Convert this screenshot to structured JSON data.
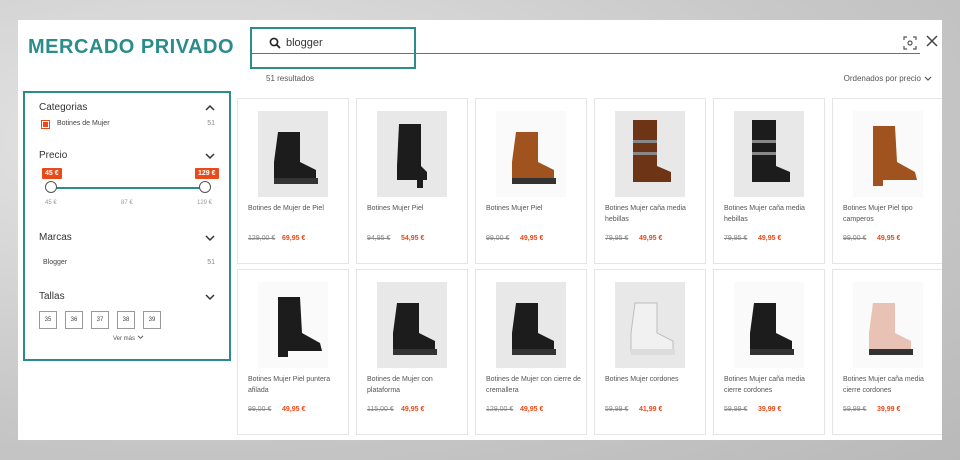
{
  "brand": {
    "logo_text": "MERCADO PRIVADO",
    "accent_color": "#2a8c8c",
    "sale_color": "#e84a1a"
  },
  "search": {
    "query": "blogger",
    "icon": "search-icon"
  },
  "toolbar": {
    "scan_icon": "scan-icon",
    "close_icon": "close-icon"
  },
  "results": {
    "count_text": "51 resultados",
    "sort_label": "Ordenados por precio"
  },
  "filters": {
    "categories": {
      "title": "Categorias",
      "items": [
        {
          "label": "Botines de Mujer",
          "count": "51",
          "checked": true
        }
      ]
    },
    "price": {
      "title": "Precio",
      "min_tag": "45 €",
      "max_tag": "129 €",
      "ticks": [
        "45 €",
        "87 €",
        "129 €"
      ]
    },
    "brands": {
      "title": "Marcas",
      "items": [
        {
          "label": "Blogger",
          "count": "51"
        }
      ]
    },
    "sizes": {
      "title": "Tallas",
      "items": [
        "35",
        "36",
        "37",
        "38",
        "39"
      ],
      "more_label": "Ver más"
    }
  },
  "products": [
    {
      "name": "Botines de Mujer de Piel",
      "old_price": "129,00 €",
      "price": "69,95 €",
      "color": "black",
      "style": "lace"
    },
    {
      "name": "Botines Mujer Piel",
      "old_price": "94,95 €",
      "price": "54,95 €",
      "color": "black",
      "style": "heel"
    },
    {
      "name": "Botines Mujer Piel",
      "old_price": "99,00 €",
      "price": "49,95 €",
      "color": "cognac",
      "style": "chelsea"
    },
    {
      "name": "Botines Mujer caña media hebillas",
      "old_price": "79,95 €",
      "price": "49,95 €",
      "color": "brown",
      "style": "buckle"
    },
    {
      "name": "Botines Mujer caña media hebillas",
      "old_price": "79,95 €",
      "price": "49,95 €",
      "color": "black",
      "style": "buckle"
    },
    {
      "name": "Botines Mujer Piel tipo camperos",
      "old_price": "99,00 €",
      "price": "49,95 €",
      "color": "cognac",
      "style": "western"
    },
    {
      "name": "Botines Mujer Piel puntera afilada",
      "old_price": "99,00 €",
      "price": "49,95 €",
      "color": "black",
      "style": "pointed"
    },
    {
      "name": "Botines de Mujer con plataforma",
      "old_price": "115,00 €",
      "price": "49,95 €",
      "color": "black",
      "style": "chelsea"
    },
    {
      "name": "Botines de Mujer con cierre de cremallera",
      "old_price": "129,00 €",
      "price": "49,95 €",
      "color": "black",
      "style": "lace"
    },
    {
      "name": "Botines Mujer cordones",
      "old_price": "59,99 €",
      "price": "41,99 €",
      "color": "white",
      "style": "lace"
    },
    {
      "name": "Botines Mujer caña media cierre cordones",
      "old_price": "59,99 €",
      "price": "39,99 €",
      "color": "black",
      "style": "lace"
    },
    {
      "name": "Botines Mujer caña media cierre cordones",
      "old_price": "59,99 €",
      "price": "39,99 €",
      "color": "pink",
      "style": "lace"
    }
  ]
}
